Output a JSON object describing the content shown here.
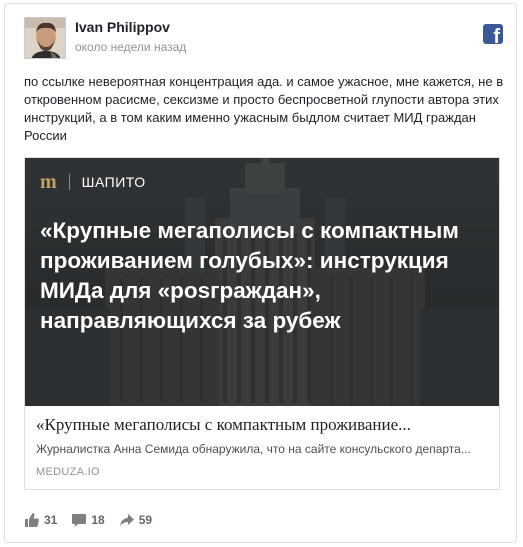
{
  "post": {
    "author": "Ivan Philippov",
    "timestamp": "около недели назад",
    "text": "по ссылке невероятная концентрация ада. и самое ужасное, мне кажется, не в откровенном расисме, сексизме и просто беспросветной глупости автора этих инструкций, а в том каким именно ужасным быдлом считает МИД граждан России"
  },
  "icons": {
    "platform": "facebook-logo-icon",
    "like": "thumbs-up-icon",
    "comment": "speech-bubble-icon",
    "share": "share-arrow-icon"
  },
  "link": {
    "hero": {
      "brand_glyph": "m",
      "rubric": "ШАПИТО",
      "title": "«Крупные мегаполисы с компактным проживанием голубых»: инструкция МИДа для «рosграждан», направляющихся за рубеж"
    },
    "title": "«Крупные мегаполисы с компактным проживание...",
    "description": "Журналистка Анна Семида обнаружила, что на сайте консульского департа...",
    "domain": "MEDUZA.IO"
  },
  "stats": {
    "likes": "31",
    "comments": "18",
    "shares": "59"
  },
  "colors": {
    "facebook_blue": "#3b5998",
    "meduza_gold": "#c2a25f",
    "muted_text": "#90949c",
    "action_gray": "#606770"
  }
}
